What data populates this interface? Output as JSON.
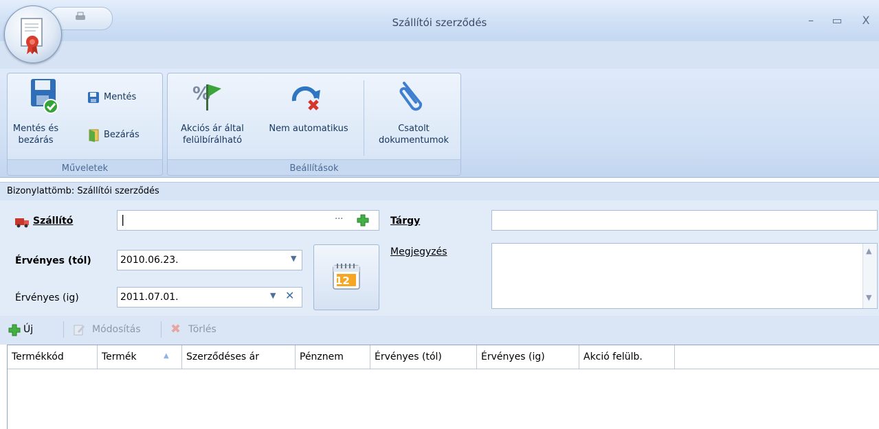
{
  "window": {
    "title": "Szállítói szerződés",
    "controls": {
      "minimize": "–",
      "maximize": "▭",
      "close": "X"
    }
  },
  "ribbon": {
    "groups": [
      {
        "label": "Műveletek",
        "buttons": {
          "save_close": "Mentés és bezárás",
          "save_close_line1": "Mentés és",
          "save_close_line2": "bezárás",
          "save": "Mentés",
          "close": "Bezárás"
        }
      },
      {
        "label": "Beállítások",
        "buttons": {
          "override_line1": "Akciós ár által",
          "override_line2": "felülbírálható",
          "not_auto": "Nem automatikus",
          "attach_line1": "Csatolt",
          "attach_line2": "dokumentumok"
        }
      }
    ]
  },
  "caption": "Bizonylattömb: Szállítói szerződés",
  "form": {
    "supplier_label": "Szállító",
    "supplier_value": "",
    "subject_label": "Tárgy",
    "subject_value": "",
    "valid_from_label": "Érvényes (tól)",
    "valid_from_value": "2010.06.23.",
    "valid_to_label": "Érvényes (ig)",
    "valid_to_value": "2011.07.01.",
    "note_label": "Megjegyzés",
    "calendar_day": "12",
    "ellipsis": "···"
  },
  "toolbar": {
    "new": "Új",
    "edit": "Módosítás",
    "delete": "Törlés"
  },
  "grid": {
    "columns": [
      "Termékkód",
      "Termék",
      "Szerződéses ár",
      "Pénznem",
      "Érvényes (tól)",
      "Érvényes (ig)",
      "Akció felülb."
    ],
    "rows": []
  },
  "colors": {
    "accent": "#cfdff4",
    "brand_red": "#c0392b",
    "green_add": "#3aa53a"
  }
}
